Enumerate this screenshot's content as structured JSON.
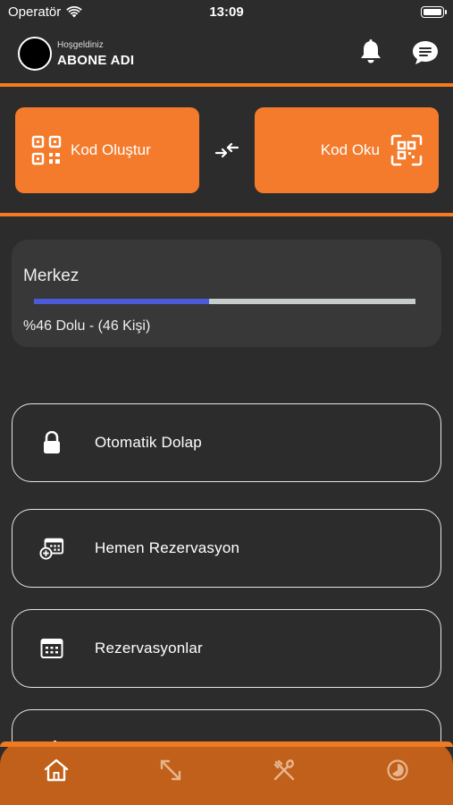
{
  "status_bar": {
    "carrier": "Operatör",
    "time": "13:09",
    "wifi_icon": "wifi-icon",
    "battery_level": 1.0
  },
  "header": {
    "welcome": "Hoşgeldiniz",
    "username": "ABONE ADI",
    "icons": [
      "bell-icon",
      "chat-bubble-icon"
    ]
  },
  "code_buttons": {
    "create_label": "Kod Oluştur",
    "read_label": "Kod Oku",
    "create_icon": "qr-code-icon",
    "read_icon": "qr-scan-icon",
    "swap_icon": "swap-arrows-icon"
  },
  "occupancy": {
    "title": "Merkez",
    "fill_fraction": 0.46,
    "info": "%46 Dolu - (46 Kişi)"
  },
  "menu": [
    {
      "label": "Otomatik Dolap",
      "icon": "lock-icon"
    },
    {
      "label": "Hemen Rezervasyon",
      "icon": "calendar-add-icon"
    },
    {
      "label": "Rezervasyonlar",
      "icon": "calendar-icon"
    },
    {
      "label": "",
      "icon": "partial-item-icon"
    }
  ],
  "tab_bar": {
    "tabs": [
      "home-icon",
      "expand-arrows-icon",
      "fork-knife-icon",
      "progress-pie-icon"
    ],
    "active_tab": "home-icon"
  },
  "colors": {
    "background": "#2c2c2c",
    "accent": "#f47b2c",
    "card": "#383838",
    "progress": "#4a5ad9",
    "progress_track": "#c6cccc",
    "tab_bar": "#c0601a"
  }
}
